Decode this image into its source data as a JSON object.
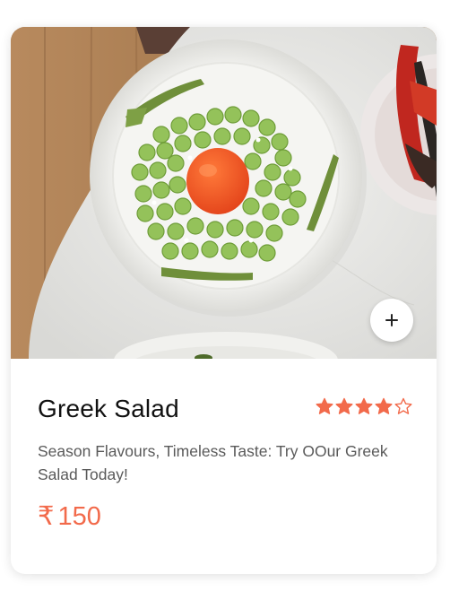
{
  "card": {
    "image_alt": "Greek Salad",
    "add_button_label": "+",
    "title": "Greek Salad",
    "rating": 4,
    "rating_max": 5,
    "description": "Season Flavours, Timeless Taste: Try OOur Greek Salad Today!",
    "currency_symbol": "₹",
    "price": "150"
  },
  "colors": {
    "accent": "#f26a4b",
    "star": "#f26a4b",
    "title": "#111111",
    "description": "#5a5a5a"
  },
  "icons": {
    "add": "plus-icon",
    "star_filled": "star-filled-icon",
    "star_empty": "star-outline-icon"
  }
}
